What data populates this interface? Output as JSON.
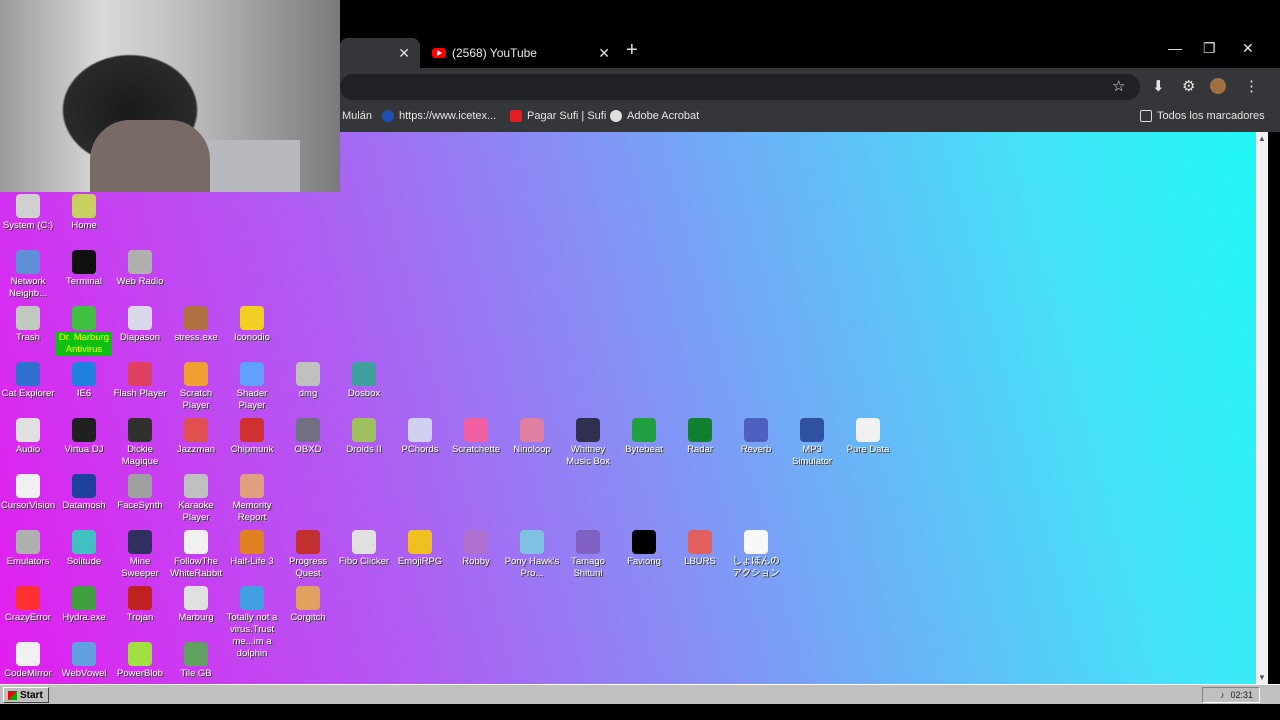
{
  "browser": {
    "tabs": [
      {
        "label": ""
      },
      {
        "label": "(2568) YouTube"
      }
    ],
    "close_glyph": "✕",
    "new_tab_glyph": "+",
    "bookmarks": [
      {
        "label": "Mulán",
        "icon": "bookmark-icon"
      },
      {
        "label": "https://www.icetex...",
        "icon": "icetex-icon"
      },
      {
        "label": "Pagar Sufi | Sufi",
        "icon": "sufi-icon"
      },
      {
        "label": "Adobe Acrobat",
        "icon": "acrobat-icon"
      },
      {
        "label": "Todos los marcadores",
        "icon": "folder-icon"
      }
    ]
  },
  "desktop": {
    "icons": [
      {
        "label": "System (C:)",
        "color": "#d0d0d0",
        "col": 0,
        "row": 0
      },
      {
        "label": "Home",
        "color": "#c8d060",
        "col": 1,
        "row": 0
      },
      {
        "label": "Network Neighb...",
        "color": "#5f8fd8",
        "col": 0,
        "row": 1
      },
      {
        "label": "Terminal",
        "color": "#101010",
        "col": 1,
        "row": 1
      },
      {
        "label": "Web Radio",
        "color": "#b0b0b0",
        "col": 2,
        "row": 1
      },
      {
        "label": "Trash",
        "color": "#c0c8c0",
        "col": 0,
        "row": 2
      },
      {
        "label": "Dr. Marburg Antivirus",
        "color": "#40c040",
        "col": 1,
        "row": 2,
        "selected": true
      },
      {
        "label": "Diapason",
        "color": "#d8d8e8",
        "col": 2,
        "row": 2
      },
      {
        "label": "stress.exe",
        "color": "#b07040",
        "col": 3,
        "row": 2
      },
      {
        "label": "Iconodio",
        "color": "#f0d020",
        "col": 4,
        "row": 2
      },
      {
        "label": "Cat Explorer",
        "color": "#3070d0",
        "col": 0,
        "row": 3
      },
      {
        "label": "IE6",
        "color": "#2080e0",
        "col": 1,
        "row": 3
      },
      {
        "label": "Flash Player",
        "color": "#e04060",
        "col": 2,
        "row": 3
      },
      {
        "label": "Scratch Player",
        "color": "#f0a030",
        "col": 3,
        "row": 3
      },
      {
        "label": "Shader Player",
        "color": "#60a0ff",
        "col": 4,
        "row": 3
      },
      {
        "label": "dmg",
        "color": "#c0c0c0",
        "col": 5,
        "row": 3
      },
      {
        "label": "Dosbox",
        "color": "#40a0a0",
        "col": 6,
        "row": 3
      },
      {
        "label": "Audio",
        "color": "#e0e0e0",
        "col": 0,
        "row": 4
      },
      {
        "label": "Virtua DJ",
        "color": "#202020",
        "col": 1,
        "row": 4
      },
      {
        "label": "Dickie Magique",
        "color": "#303030",
        "col": 2,
        "row": 4
      },
      {
        "label": "Jazzman",
        "color": "#e05050",
        "col": 3,
        "row": 4
      },
      {
        "label": "Chipmunk",
        "color": "#d03030",
        "col": 4,
        "row": 4
      },
      {
        "label": "OBXD",
        "color": "#707080",
        "col": 5,
        "row": 4
      },
      {
        "label": "Droids II",
        "color": "#a0c060",
        "col": 6,
        "row": 4
      },
      {
        "label": "PChords",
        "color": "#d0d0f0",
        "col": 7,
        "row": 4
      },
      {
        "label": "Scratchette",
        "color": "#f060a0",
        "col": 8,
        "row": 4
      },
      {
        "label": "Ninoloop",
        "color": "#e080a0",
        "col": 9,
        "row": 4
      },
      {
        "label": "Whitney Music Box",
        "color": "#303050",
        "col": 10,
        "row": 4
      },
      {
        "label": "Bytebeat",
        "color": "#20a040",
        "col": 11,
        "row": 4
      },
      {
        "label": "Radar",
        "color": "#108030",
        "col": 12,
        "row": 4
      },
      {
        "label": "Reverb",
        "color": "#5060c0",
        "col": 13,
        "row": 4
      },
      {
        "label": "MP3 Simulator",
        "color": "#3050a0",
        "col": 14,
        "row": 4
      },
      {
        "label": "Pure Data",
        "color": "#f0f0f0",
        "col": 15,
        "row": 4
      },
      {
        "label": "CursorVision",
        "color": "#f0f0f0",
        "col": 0,
        "row": 5
      },
      {
        "label": "Datamosh",
        "color": "#2040a0",
        "col": 1,
        "row": 5
      },
      {
        "label": "FaceSynth",
        "color": "#a0a0a0",
        "col": 2,
        "row": 5
      },
      {
        "label": "Karaoke Player",
        "color": "#c0c0c0",
        "col": 3,
        "row": 5
      },
      {
        "label": "Memority Report",
        "color": "#e0a080",
        "col": 4,
        "row": 5
      },
      {
        "label": "Emulators",
        "color": "#b0b0b0",
        "col": 0,
        "row": 6
      },
      {
        "label": "Solitude",
        "color": "#40c0c0",
        "col": 1,
        "row": 6
      },
      {
        "label": "Mine Sweeper",
        "color": "#303060",
        "col": 2,
        "row": 6
      },
      {
        "label": "FollowThe WhiteRabbit",
        "color": "#f0f0f0",
        "col": 3,
        "row": 6
      },
      {
        "label": "Half-Life 3",
        "color": "#e08020",
        "col": 4,
        "row": 6
      },
      {
        "label": "Progress Quest",
        "color": "#c03030",
        "col": 5,
        "row": 6
      },
      {
        "label": "Fibo Clicker",
        "color": "#e0e0e0",
        "col": 6,
        "row": 6
      },
      {
        "label": "EmojiRPG",
        "color": "#f0c020",
        "col": 7,
        "row": 6
      },
      {
        "label": "Robby",
        "color": "#b070d0",
        "col": 8,
        "row": 6
      },
      {
        "label": "Pony Hawk's Pro...",
        "color": "#80c0e0",
        "col": 9,
        "row": 6
      },
      {
        "label": "Tamago Shituni",
        "color": "#8060c0",
        "col": 10,
        "row": 6
      },
      {
        "label": "Faviong",
        "color": "#000000",
        "col": 11,
        "row": 6
      },
      {
        "label": "LBURS",
        "color": "#e06060",
        "col": 12,
        "row": 6
      },
      {
        "label": "しょぼんのアクション",
        "color": "#f8f8f8",
        "col": 13,
        "row": 6
      },
      {
        "label": "CrazyError",
        "color": "#ff3030",
        "col": 0,
        "row": 7
      },
      {
        "label": "Hydra.exe",
        "color": "#40a040",
        "col": 1,
        "row": 7
      },
      {
        "label": "Trojan",
        "color": "#c02020",
        "col": 2,
        "row": 7
      },
      {
        "label": "Marburg",
        "color": "#e0e0e0",
        "col": 3,
        "row": 7
      },
      {
        "label": "Totally not a virus.Trust me...im a dolphin",
        "color": "#40a0e0",
        "col": 4,
        "row": 7
      },
      {
        "label": "Corgitch",
        "color": "#e0a060",
        "col": 5,
        "row": 7
      },
      {
        "label": "CodeMirror",
        "color": "#f0f0f0",
        "col": 0,
        "row": 8
      },
      {
        "label": "WebVowel",
        "color": "#60a0e0",
        "col": 1,
        "row": 8
      },
      {
        "label": "PowerBlob",
        "color": "#a0e040",
        "col": 2,
        "row": 8
      },
      {
        "label": "Tile GB",
        "color": "#60a060",
        "col": 3,
        "row": 8
      }
    ]
  },
  "taskbar": {
    "start_label": "Start",
    "clock": "02:31"
  }
}
